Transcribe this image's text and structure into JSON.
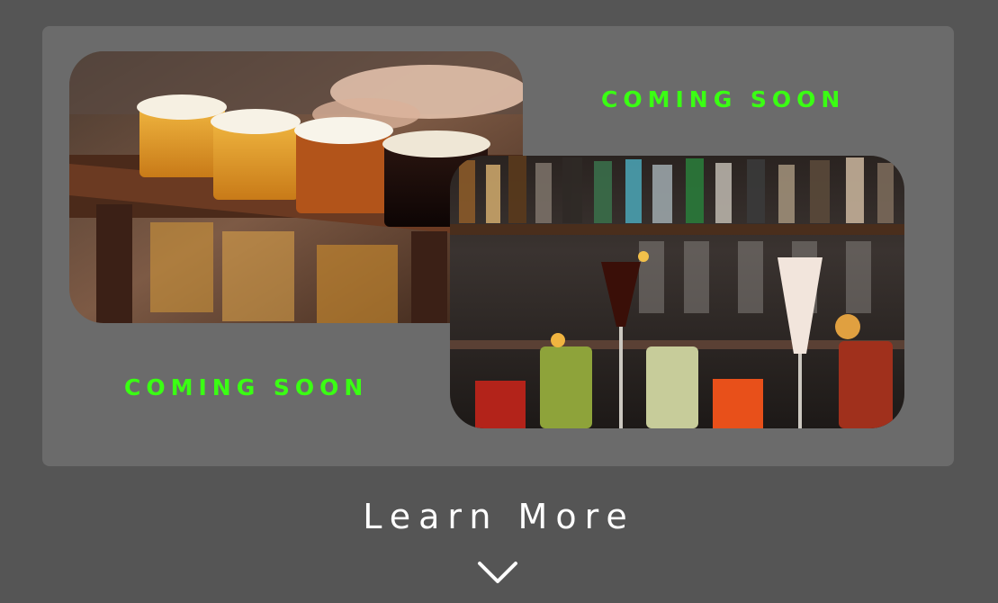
{
  "section": {
    "coming_soon_top": "COMING SOON",
    "coming_soon_bottom": "COMING SOON"
  },
  "images": {
    "beer_flight": "beer-flight-photo",
    "cocktails": "cocktail-bar-photo"
  },
  "learn_more": {
    "label": "Learn More",
    "icon": "chevron-down-icon"
  },
  "colors": {
    "background": "#555555",
    "panel": "#6b6b6b",
    "accent_green": "#3aff13",
    "text": "#ffffff"
  }
}
